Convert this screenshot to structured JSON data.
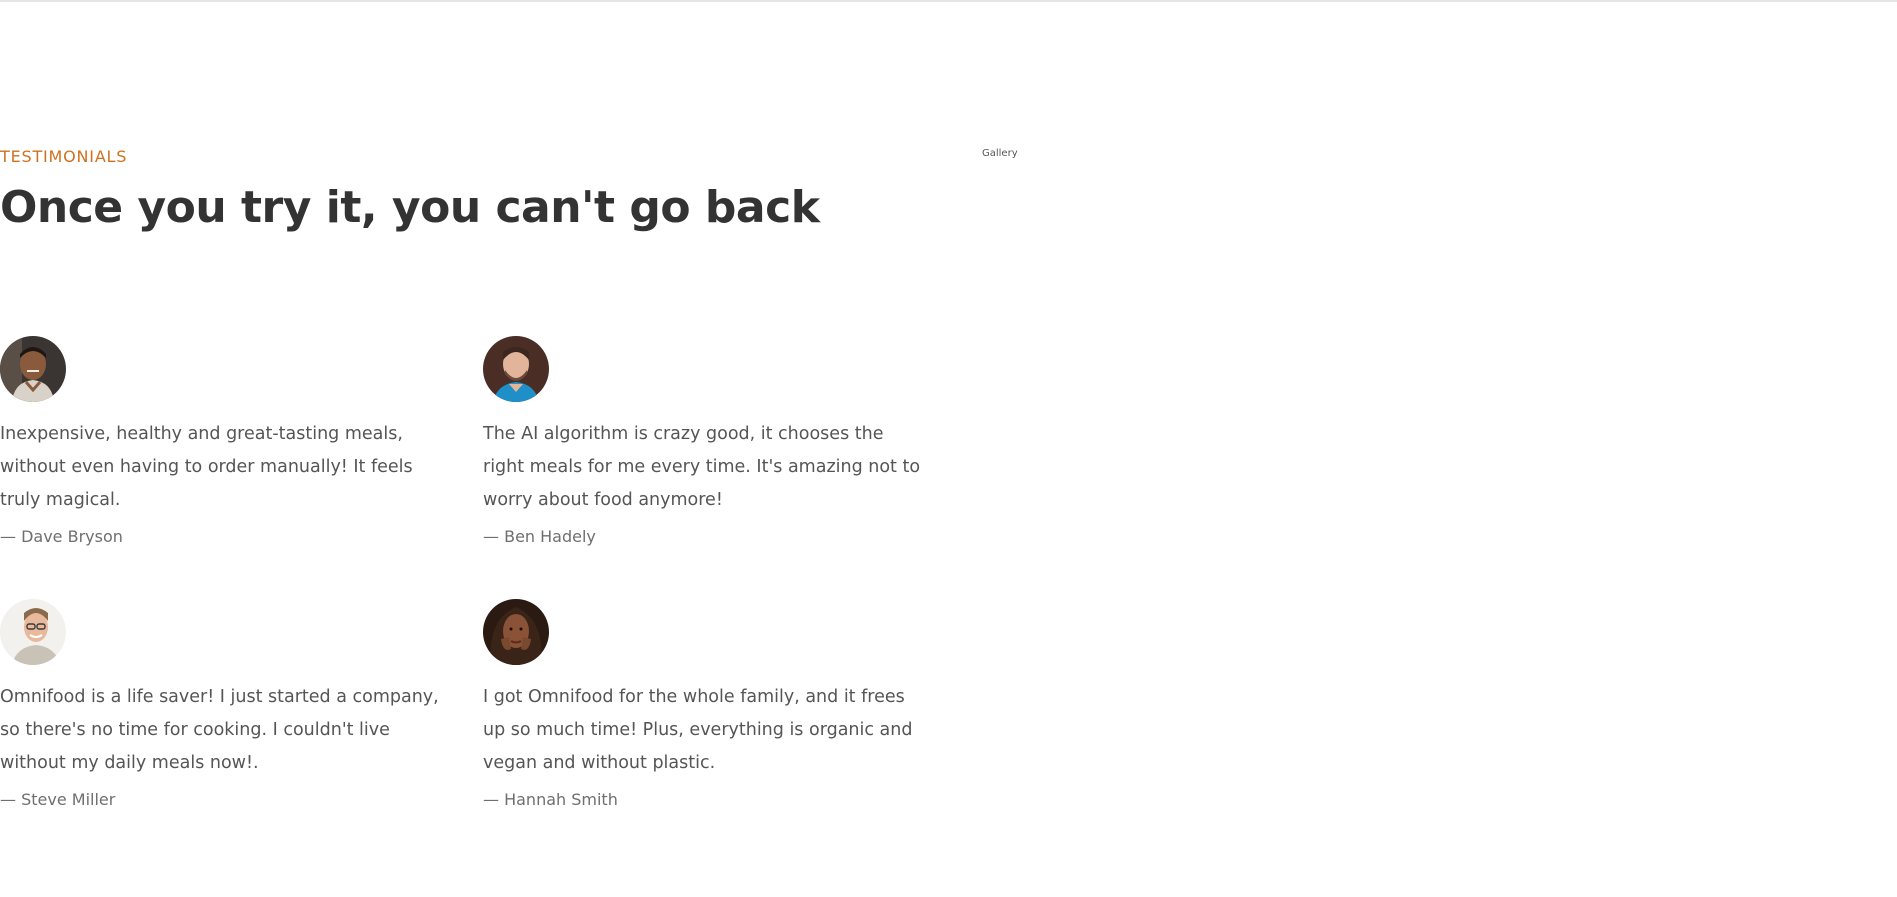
{
  "section": {
    "subheading": "TESTIMONIALS",
    "heading": "Once you try it, you can't go back",
    "gallery_label": "Gallery"
  },
  "testimonials": [
    {
      "quote": "Inexpensive, healthy and great-tasting meals, without even having to order manually! It feels truly magical.",
      "author": "— Dave Bryson",
      "avatar_icon": "person-photo-icon"
    },
    {
      "quote": "The AI algorithm is crazy good, it chooses the right meals for me every time. It's amazing not to worry about food anymore!",
      "author": "— Ben Hadely",
      "avatar_icon": "person-photo-icon"
    },
    {
      "quote": "Omnifood is a life saver! I just started a company, so there's no time for cooking. I couldn't live without my daily meals now!.",
      "author": "— Steve Miller",
      "avatar_icon": "person-photo-icon"
    },
    {
      "quote": "I got Omnifood for the whole family, and it frees up so much time! Plus, everything is organic and vegan and without plastic.",
      "author": "— Hannah Smith",
      "avatar_icon": "person-photo-icon"
    }
  ],
  "colors": {
    "accent": "#cf711f",
    "heading": "#333333",
    "body_text": "#555555",
    "author_text": "#6f6f6f"
  }
}
